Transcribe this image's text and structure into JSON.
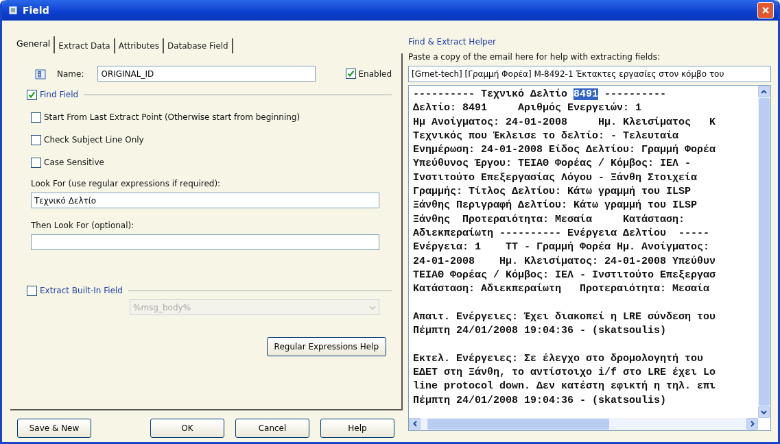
{
  "window": {
    "title": "Field"
  },
  "tabs": [
    {
      "label": "General",
      "selected": true
    },
    {
      "label": "Extract Data",
      "selected": false
    },
    {
      "label": "Attributes",
      "selected": false
    },
    {
      "label": "Database Field",
      "selected": false
    }
  ],
  "general": {
    "name_label": "Name:",
    "name_value": "ORIGINAL_ID",
    "enabled": {
      "label": "Enabled",
      "checked": true
    },
    "find_field": {
      "label": "Find Field",
      "checked": true
    },
    "options": [
      {
        "label": "Start From Last Extract Point (Otherwise start from beginning)",
        "checked": false
      },
      {
        "label": "Check Subject Line Only",
        "checked": false
      },
      {
        "label": "Case Sensitive",
        "checked": false
      }
    ],
    "look_for_label": "Look For (use regular expressions if required):",
    "look_for_value": "Τεχνικό Δελτίο",
    "then_look_for_label": "Then Look For (optional):",
    "extract_builtin": {
      "label": "Extract Built-In Field",
      "checked": false,
      "value": "%msg_body%",
      "disabled": true
    },
    "regex_help_button": "Regular Expressions Help"
  },
  "buttons": [
    {
      "label": "Save & New"
    },
    {
      "label": "OK"
    },
    {
      "label": "Cancel"
    },
    {
      "label": "Help"
    }
  ],
  "helper": {
    "title": "Find & Extract Helper",
    "instruction": "Paste a copy of the email here for help with extracting fields:",
    "subject": "[Grnet-tech] [Γραμμή Φορέα] M-8492-1 Έκτακτες εργασίες στον κόμβο του",
    "header_line": [
      {
        "text": "---------- Τεχνικό Δελτίο ",
        "selected": false
      },
      {
        "text": "8491",
        "selected": true
      },
      {
        "text": " ----------",
        "selected": false
      }
    ],
    "paragraphs": [
      [
        "Δελτίο: 8491     Αριθμός Ενεργειών: 1",
        "Ημ Ανοίγματος: 24-01-2008     Ημ. Κλεισίματος   Κ",
        "Τεχνικός που Έκλεισε το δελτίο: - Τελευταία",
        "Ενημέρωση: 24-01-2008 Είδος Δελτίου: Γραμμή Φορέα",
        "Υπεύθυνος Έργου: ΤΕΙΑΘ Φορέας / Κόμβος: ΙΕΛ -",
        "Ινστιτούτο Επεξεργασίας Λόγου - Ξάνθη Στοιχεία",
        "Γραμμής: Τίτλος Δελτίου: Κάτω γραμμή του ILSP",
        "Ξάνθης Περιγραφή Δελτίου: Κάτω γραμμή του ILSP",
        "Ξάνθης  Προτεραιότητα: Μεσαία     Κατάσταση:",
        "Αδιεκπεραίωτη ---------- Ενέργεια Δελτίου  -----",
        "Ενέργεια: 1    TT - Γραμμή Φορέα Ημ. Ανοίγματος:",
        "24-01-2008    Ημ. Κλεισίματος: 24-01-2008 Υπεύθυν",
        "ΤΕΙΑΘ Φορέας / Κόμβος: ΙΕΛ - Ινστιτούτο Επεξεργασ",
        "Κατάσταση: Αδιεκπεραίωτη   Προτεραιότητα: Μεσαία"
      ],
      [
        "Απαιτ. Ενέργειες: Έχει διακοπεί η LRE σύνδεση του",
        "Πέμπτη 24/01/2008 19:04:36 - (skatsoulis)"
      ],
      [
        "Εκτελ. Ενέργειες: Σε έλεγχο στο δρομολογητή του",
        "ΕΔΕΤ στη Ξάνθη, το αντίστοιχο i/f στο LRE έχει Lo",
        "line protocol down. Δεν κατέστη εφικτή η τηλ. επι",
        "Πέμπτη 24/01/2008 19:04:36 - (skatsoulis)"
      ]
    ]
  }
}
